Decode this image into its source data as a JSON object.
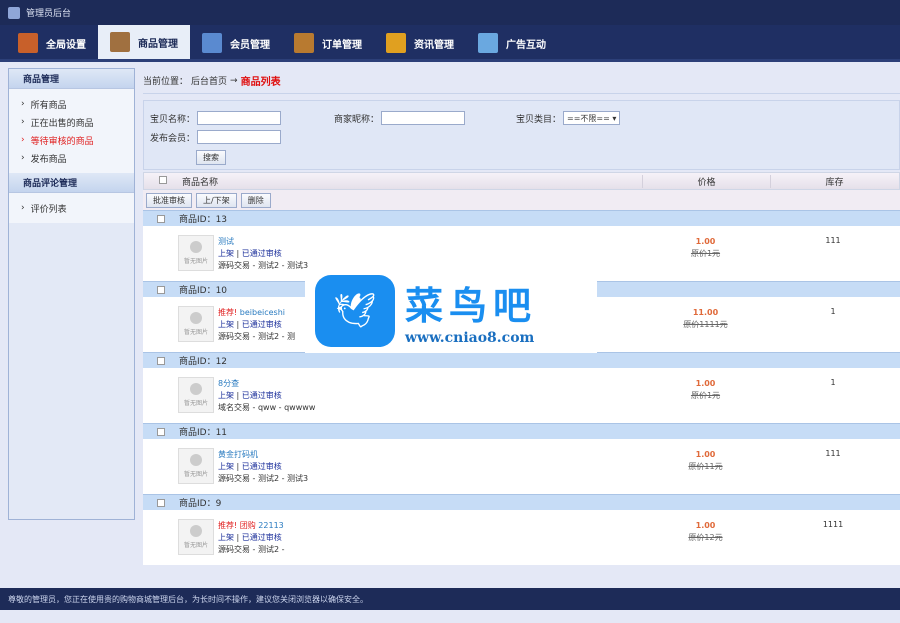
{
  "app": {
    "title": "管理员后台"
  },
  "nav": [
    {
      "label": "全局设置",
      "color": "#c8602a"
    },
    {
      "label": "商品管理",
      "color": "#a07040"
    },
    {
      "label": "会员管理",
      "color": "#5a8ad0"
    },
    {
      "label": "订单管理",
      "color": "#b87a30"
    },
    {
      "label": "资讯管理",
      "color": "#e0a020"
    },
    {
      "label": "广告互动",
      "color": "#6aa8e0"
    }
  ],
  "sidebar": {
    "groups": [
      {
        "title": "商品管理",
        "items": [
          "所有商品",
          "正在出售的商品",
          "等待审核的商品",
          "发布商品"
        ]
      },
      {
        "title": "商品评论管理",
        "items": [
          "评价列表"
        ]
      }
    ]
  },
  "breadcrumb": {
    "prefix": "当前位置：",
    "home": "后台首页",
    "sep": "→",
    "current": "商品列表"
  },
  "search": {
    "name_label": "宝贝名称：",
    "seller_label": "商家昵称：",
    "category_label": "宝贝类目：",
    "category_value": "==不限==",
    "member_label": "发布会员：",
    "button": "搜索"
  },
  "table": {
    "col_name": "商品名称",
    "col_price": "价格",
    "col_stock": "库存"
  },
  "actions": [
    "批准审核",
    "上/下架",
    "删除"
  ],
  "products": [
    {
      "id_label": "商品ID：13",
      "rec": "",
      "name": "测试",
      "status": "上架",
      "audit": "已通过审核",
      "trade": "源码交易 - 测试2 - 测试3",
      "price": "1.00",
      "orig": "原价1元",
      "stock": "111"
    },
    {
      "id_label": "商品ID：10",
      "rec": "推荐!",
      "name": "beibeiceshi",
      "status": "上架",
      "audit": "已通过审核",
      "trade": "源码交易 - 测试2 - 测",
      "price": "11.00",
      "orig": "原价1111元",
      "stock": "1"
    },
    {
      "id_label": "商品ID：12",
      "rec": "",
      "name": "8分查",
      "status": "上架",
      "audit": "已通过审核",
      "trade": "域名交易 - qww - qwwww",
      "price": "1.00",
      "orig": "原价1元",
      "stock": "1"
    },
    {
      "id_label": "商品ID：11",
      "rec": "",
      "name": "黄金打码机",
      "status": "上架",
      "audit": "已通过审核",
      "trade": "源码交易 - 测试2 - 测试3",
      "price": "1.00",
      "orig": "原价11元",
      "stock": "111"
    },
    {
      "id_label": "商品ID：9",
      "rec": "推荐! 团购",
      "name": "22113",
      "status": "上架",
      "audit": "已通过审核",
      "trade": "源码交易 - 测试2 -",
      "price": "1.00",
      "orig": "原价12元",
      "stock": "1111"
    }
  ],
  "thumb_text": "暂无图片",
  "footer": "尊敬的管理员，您正在使用贵的购物商城管理后台，为长时间不操作，建议您关闭浏览器以确保安全。",
  "watermark": {
    "title": "菜鸟吧",
    "url": "www.cniao8.com"
  }
}
